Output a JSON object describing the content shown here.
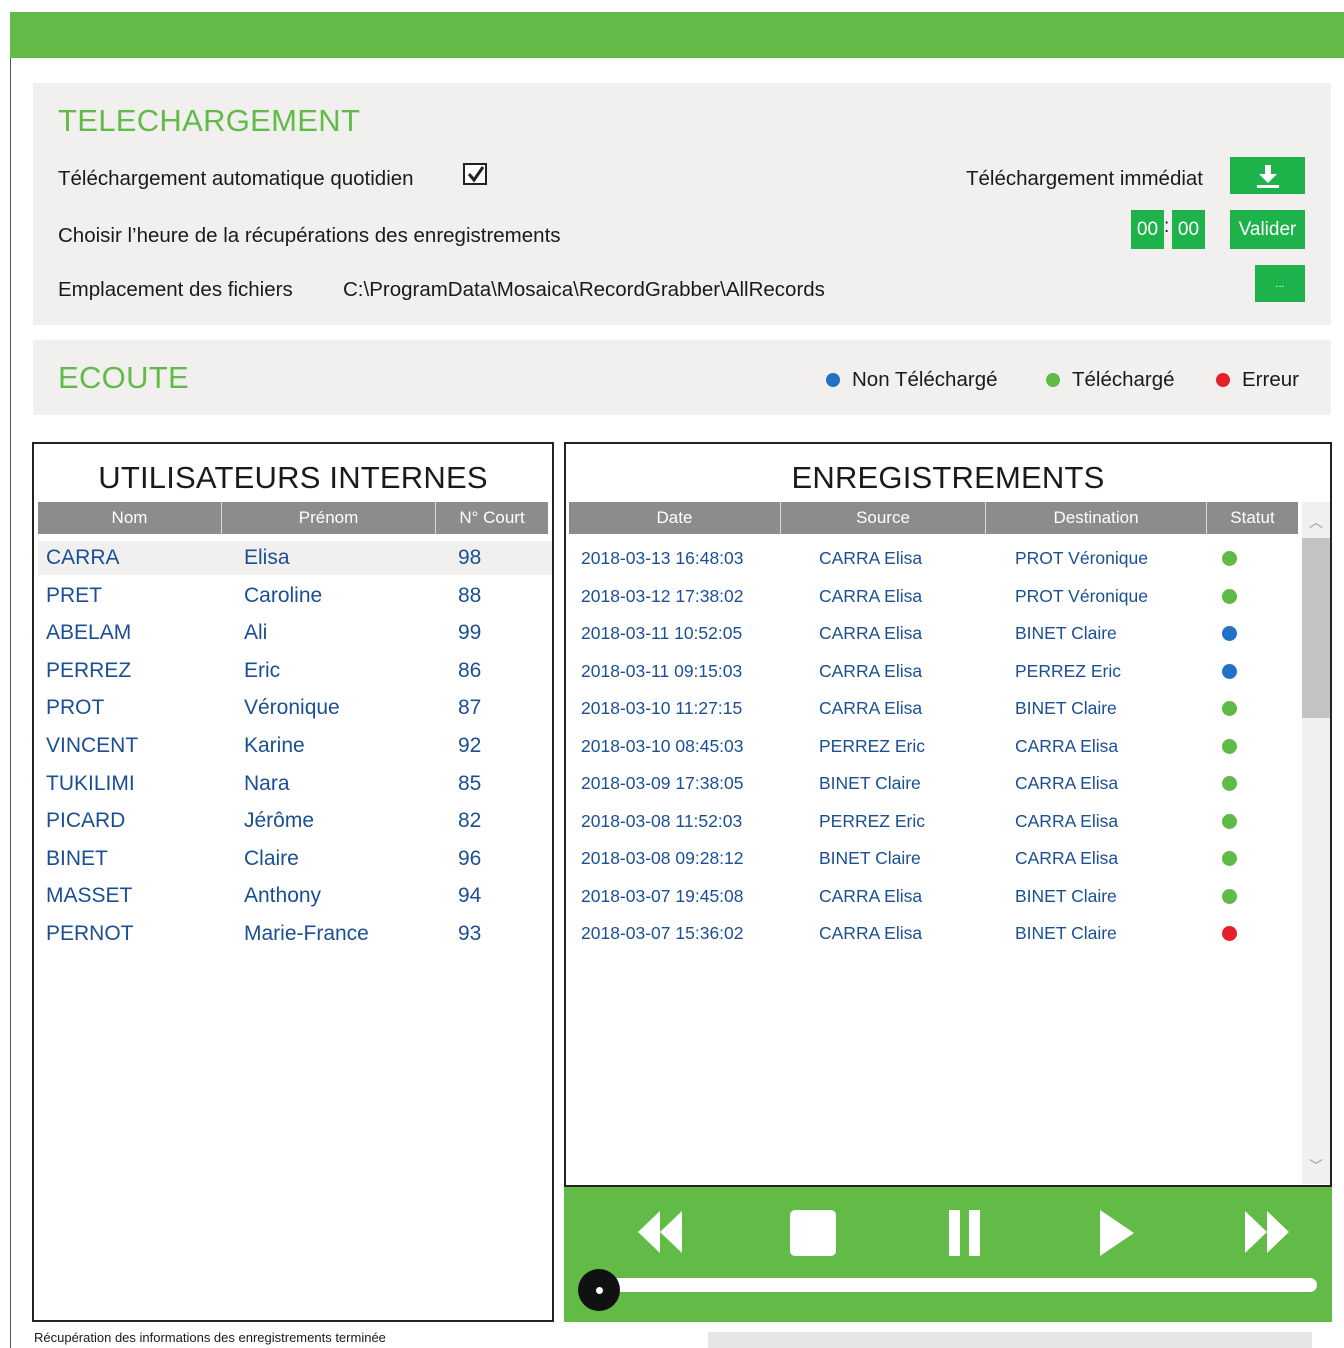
{
  "download": {
    "title": "TELECHARGEMENT",
    "auto_label": "Téléchargement automatique quotidien",
    "auto_checked": true,
    "immediate_label": "Téléchargement immédiat",
    "time_label": "Choisir l’heure de la récupérations des enregistrements",
    "time_hours": "00",
    "time_separator": ":",
    "time_minutes": "00",
    "validate_label": "Valider",
    "location_label": "Emplacement des fichiers",
    "location_path": "C:\\ProgramData\\Mosaica\\RecordGrabber\\AllRecords",
    "browse_label": "..."
  },
  "listen": {
    "title": "ECOUTE",
    "legend": [
      {
        "label": "Non Téléchargé",
        "color": "#1f72c4"
      },
      {
        "label": "Téléchargé",
        "color": "#5fba46"
      },
      {
        "label": "Erreur",
        "color": "#e5202b"
      }
    ]
  },
  "users": {
    "title": "UTILISATEURS INTERNES",
    "columns": [
      "Nom",
      "Prénom",
      "N° Court"
    ],
    "selected_index": 0,
    "rows": [
      {
        "nom": "CARRA",
        "prenom": "Elisa",
        "court": "98"
      },
      {
        "nom": "PRET",
        "prenom": "Caroline",
        "court": "88"
      },
      {
        "nom": "ABELAM",
        "prenom": "Ali",
        "court": "99"
      },
      {
        "nom": "PERREZ",
        "prenom": "Eric",
        "court": "86"
      },
      {
        "nom": "PROT",
        "prenom": "Véronique",
        "court": "87"
      },
      {
        "nom": "VINCENT",
        "prenom": "Karine",
        "court": "92"
      },
      {
        "nom": "TUKILIMI",
        "prenom": "Nara",
        "court": "85"
      },
      {
        "nom": "PICARD",
        "prenom": "Jérôme",
        "court": "82"
      },
      {
        "nom": "BINET",
        "prenom": "Claire",
        "court": "96"
      },
      {
        "nom": "MASSET",
        "prenom": "Anthony",
        "court": "94"
      },
      {
        "nom": "PERNOT",
        "prenom": "Marie-France",
        "court": "93"
      }
    ]
  },
  "records": {
    "title": "ENREGISTREMENTS",
    "columns": [
      "Date",
      "Source",
      "Destination",
      "Statut"
    ],
    "rows": [
      {
        "date": "2018-03-13 16:48:03",
        "source": "CARRA Elisa",
        "destination": "PROT Véronique",
        "status": "Téléchargé"
      },
      {
        "date": "2018-03-12 17:38:02",
        "source": "CARRA Elisa",
        "destination": "PROT Véronique",
        "status": "Téléchargé"
      },
      {
        "date": "2018-03-11 10:52:05",
        "source": "CARRA Elisa",
        "destination": "BINET Claire",
        "status": "Non Téléchargé"
      },
      {
        "date": "2018-03-11 09:15:03",
        "source": "CARRA Elisa",
        "destination": "PERREZ Eric",
        "status": "Non Téléchargé"
      },
      {
        "date": "2018-03-10 11:27:15",
        "source": "CARRA Elisa",
        "destination": "BINET Claire",
        "status": "Téléchargé"
      },
      {
        "date": "2018-03-10 08:45:03",
        "source": "PERREZ Eric",
        "destination": "CARRA Elisa",
        "status": "Téléchargé"
      },
      {
        "date": "2018-03-09 17:38:05",
        "source": "BINET Claire",
        "destination": "CARRA Elisa",
        "status": "Téléchargé"
      },
      {
        "date": "2018-03-08 11:52:03",
        "source": "PERREZ Eric",
        "destination": "CARRA Elisa",
        "status": "Téléchargé"
      },
      {
        "date": "2018-03-08 09:28:12",
        "source": "BINET Claire",
        "destination": "CARRA Elisa",
        "status": "Téléchargé"
      },
      {
        "date": "2018-03-07 19:45:08",
        "source": "CARRA Elisa",
        "destination": "BINET Claire",
        "status": "Téléchargé"
      },
      {
        "date": "2018-03-07 15:36:02",
        "source": "CARRA Elisa",
        "destination": "BINET Claire",
        "status": "Erreur"
      }
    ]
  },
  "player": {
    "controls": [
      "rewind-icon",
      "stop-icon",
      "pause-icon",
      "play-icon",
      "fast-forward-icon"
    ],
    "progress": 0
  },
  "status_bar": {
    "message": "Récupération des informations des enregistrements terminée"
  },
  "colors": {
    "brand_green": "#63bb47",
    "button_green": "#1db34a",
    "text_blue": "#1b4f93",
    "header_gray": "#8d8c8c"
  }
}
